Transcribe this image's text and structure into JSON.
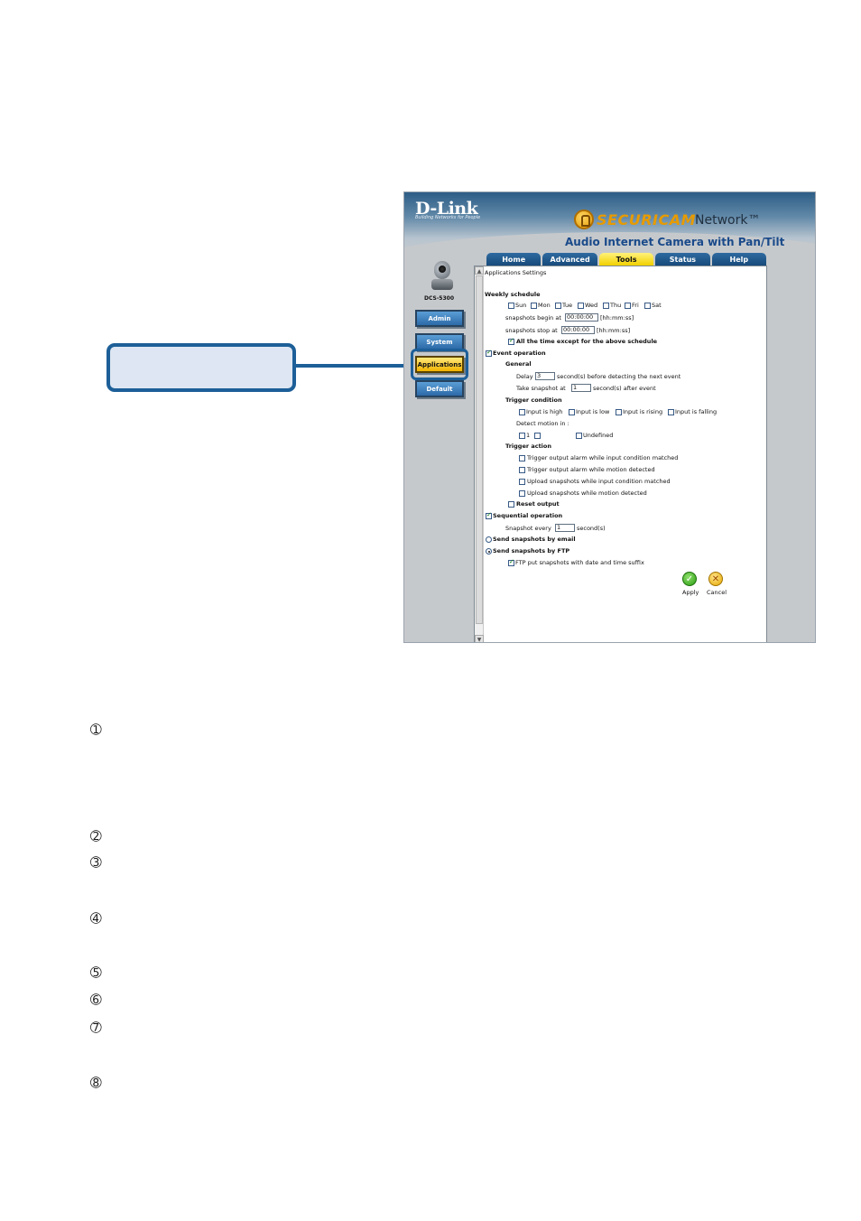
{
  "header": {
    "brand": "D-Link",
    "tagline": "Building Networks for People",
    "product_logo": "SECURICAM",
    "product_network": "Network™",
    "subtitle": "Audio Internet Camera with Pan/Tilt"
  },
  "sidebar": {
    "model": "DCS-5300",
    "items": [
      {
        "label": "Admin"
      },
      {
        "label": "System"
      },
      {
        "label": "Applications"
      },
      {
        "label": "Default"
      }
    ]
  },
  "tabs": [
    {
      "label": "Home"
    },
    {
      "label": "Advanced"
    },
    {
      "label": "Tools"
    },
    {
      "label": "Status"
    },
    {
      "label": "Help"
    }
  ],
  "panel": {
    "title": "Applications Settings",
    "weekly": {
      "heading": "Weekly schedule",
      "days": [
        "Sun",
        "Mon",
        "Tue",
        "Wed",
        "Thu",
        "Fri",
        "Sat"
      ],
      "begin_label": "snapshots begin at",
      "begin_value": "00:00:00",
      "begin_hint": "[hh:mm:ss]",
      "stop_label": "snapshots stop at",
      "stop_value": "00:00:00",
      "stop_hint": "[hh:mm:ss]",
      "except_label": "All the time except for the above schedule"
    },
    "event": {
      "label": "Event operation",
      "general": "General",
      "delay_label": "Delay",
      "delay_value": "3",
      "delay_suffix": "second(s) before detecting the next event",
      "take_label": "Take snapshot at",
      "take_value": "1",
      "take_suffix": "second(s) after event",
      "trigger_condition": "Trigger condition",
      "conditions": [
        "Input is high",
        "Input is low",
        "Input is rising",
        "Input is falling"
      ],
      "detect_label": "Detect motion in :",
      "motion_one": "1",
      "motion_undefined": "Undefined",
      "trigger_action": "Trigger action",
      "actions": [
        "Trigger output alarm while input condition matched",
        "Trigger output alarm while motion detected",
        "Upload snapshots while input condition matched",
        "Upload snapshots while motion detected"
      ],
      "reset_output": "Reset output"
    },
    "sequential": {
      "label": "Sequential operation",
      "every_label": "Snapshot every",
      "every_value": "1",
      "every_suffix": "second(s)"
    },
    "send_email": "Send snapshots by email",
    "send_ftp": "Send snapshots by FTP",
    "ftp_suffix": "FTP put snapshots with date and time suffix",
    "apply": "Apply",
    "cancel": "Cancel"
  },
  "markers": [
    "➀",
    "➁",
    "➂",
    "➃",
    "➄",
    "➅",
    "➆",
    "➇"
  ],
  "colors": {
    "callout_border": "#1d5f98",
    "tab_active": "#f2d000",
    "nav_active": "#f3b400"
  }
}
